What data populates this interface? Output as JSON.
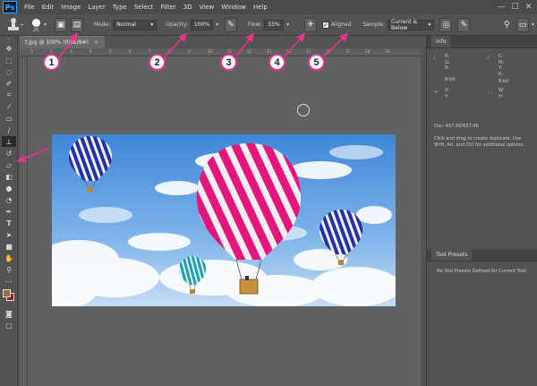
{
  "app": {
    "logo": "Ps"
  },
  "menu": [
    "File",
    "Edit",
    "Image",
    "Layer",
    "Type",
    "Select",
    "Filter",
    "3D",
    "View",
    "Window",
    "Help"
  ],
  "window_controls": [
    "—",
    "☐",
    "✕"
  ],
  "options_bar": {
    "brush_size": "25",
    "mode_label": "Mode:",
    "mode_value": "Normal",
    "opacity_label": "Opacity:",
    "opacity_value": "100%",
    "flow_label": "Flow:",
    "flow_value": "55%",
    "aligned_label": "Aligned",
    "aligned_checked": true,
    "sample_label": "Sample:",
    "sample_value": "Current & Below"
  },
  "document": {
    "tab_title": "t.jpg @ 100% (RGB/8#)",
    "close_glyph": "×",
    "ruler_numbers": [
      "1",
      "2",
      "3",
      "4",
      "5",
      "6",
      "7",
      "8",
      "9",
      "10",
      "11",
      "12",
      "13",
      "14",
      "15",
      "16",
      "17",
      "18",
      "19"
    ]
  },
  "callouts": [
    "1",
    "2",
    "3",
    "4",
    "5"
  ],
  "info_panel": {
    "title": "Info",
    "rgb_labels": "R:\nG:\nB:",
    "cmyk_labels": "C:\nM:\nY:\nK:",
    "bit_left": "8-bit",
    "bit_right": "8-bit",
    "xy_labels": "X:\nY:",
    "wh_labels": "W:\nH:",
    "doc_size": "Doc: 657.6K/657.6K",
    "help": "Click and drag to create duplicate.  Use Shift, Alt, and Ctrl for additional options."
  },
  "tool_presets": {
    "title": "Tool Presets",
    "message": "No Tool Presets Defined for Current Tool."
  },
  "colors": {
    "accent_pink": "#e8348f",
    "foreground_swatch": "#9c6a4e",
    "background_swatch": "#8c1f1c"
  }
}
